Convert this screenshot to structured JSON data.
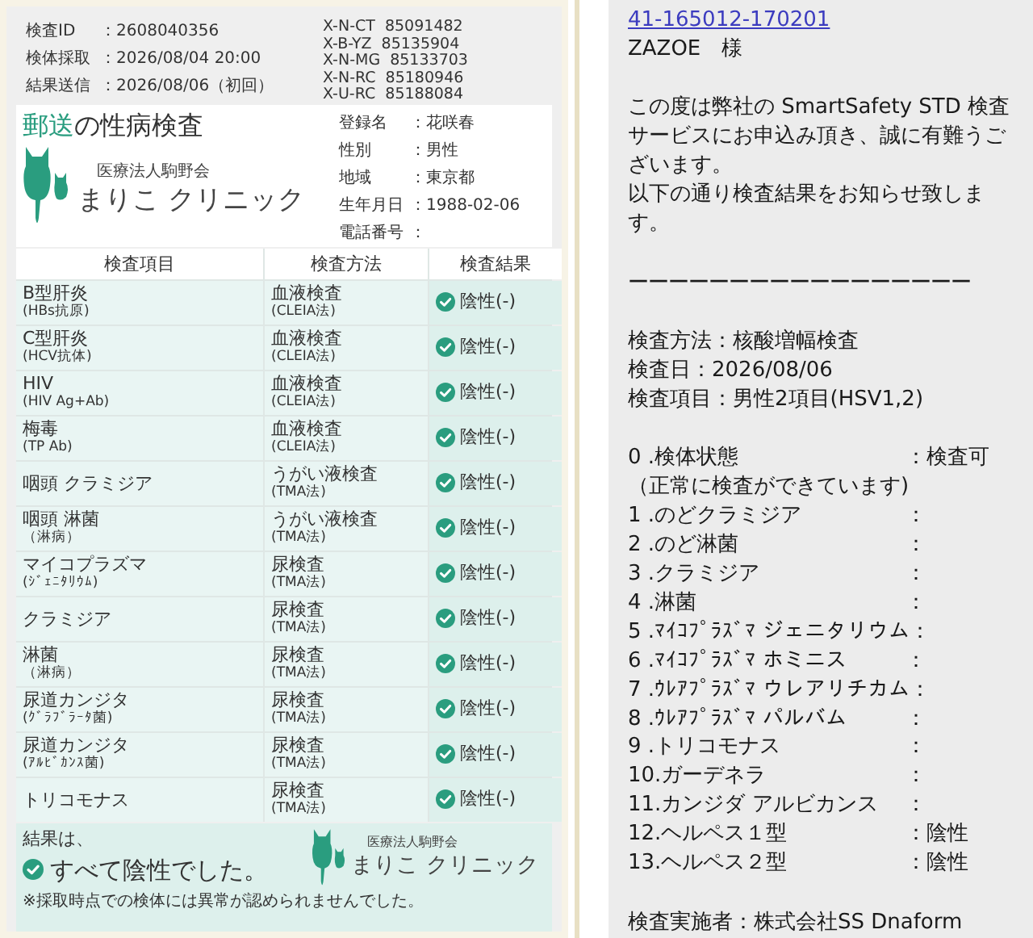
{
  "report": {
    "meta": [
      {
        "label": "検査ID",
        "value": "：2608040356"
      },
      {
        "label": "検体採取",
        "value": "：2026/08/04  20:00"
      },
      {
        "label": "結果送信",
        "value": "：2026/08/06（初回）"
      }
    ],
    "codes": [
      "X-N-CT  85091482",
      "X-B-YZ  85135904",
      "X-N-MG  85133703",
      "X-N-RC  85180946",
      "X-U-RC  85188084"
    ],
    "title": {
      "highlight": "郵送",
      "rest": "の性病検査"
    },
    "clinic": {
      "org": "医療法人駒野会",
      "name": "まりこ クリニック"
    },
    "patient": [
      {
        "label": "登録名",
        "value": "：花咲春"
      },
      {
        "label": "性別",
        "value": "：男性"
      },
      {
        "label": "地域",
        "value": "：東京都"
      },
      {
        "label": "生年月日",
        "value": "：1988-02-06"
      },
      {
        "label": "電話番号",
        "value": "："
      }
    ],
    "columns": [
      "検査項目",
      "検査方法",
      "検査結果"
    ],
    "rows": [
      {
        "item": "B型肝炎",
        "item_sub": "(HBs抗原)",
        "method": "血液検査",
        "method_sub": "(CLEIA法)",
        "result": "陰性(-)"
      },
      {
        "item": "C型肝炎",
        "item_sub": "(HCV抗体)",
        "method": "血液検査",
        "method_sub": "(CLEIA法)",
        "result": "陰性(-)"
      },
      {
        "item": "HIV",
        "item_sub": "(HIV  Ag+Ab)",
        "method": "血液検査",
        "method_sub": "(CLEIA法)",
        "result": "陰性(-)"
      },
      {
        "item": "梅毒",
        "item_sub": "(TP  Ab)",
        "method": "血液検査",
        "method_sub": "(CLEIA法)",
        "result": "陰性(-)"
      },
      {
        "item": "咽頭  クラミジア",
        "method": "うがい液検査",
        "method_sub": "(TMA法)",
        "result": "陰性(-)"
      },
      {
        "item": "咽頭  淋菌",
        "item_sub": "（淋病）",
        "method": "うがい液検査",
        "method_sub": "(TMA法)",
        "result": "陰性(-)"
      },
      {
        "item": "マイコプラズマ",
        "item_sub": "(ｼﾞｪﾆﾀﾘｳﾑ)",
        "method": "尿検査",
        "method_sub": "(TMA法)",
        "result": "陰性(-)"
      },
      {
        "item": "クラミジア",
        "method": "尿検査",
        "method_sub": "(TMA法)",
        "result": "陰性(-)"
      },
      {
        "item": "淋菌",
        "item_sub": "（淋病）",
        "method": "尿検査",
        "method_sub": "(TMA法)",
        "result": "陰性(-)"
      },
      {
        "item": "尿道カンジタ",
        "item_sub": "(ｸﾞﾗﾌﾞﾗｰﾀ菌)",
        "method": "尿検査",
        "method_sub": "(TMA法)",
        "result": "陰性(-)"
      },
      {
        "item": "尿道カンジタ",
        "item_sub": "(ｱﾙﾋﾞｶﾝｽ菌)",
        "method": "尿検査",
        "method_sub": "(TMA法)",
        "result": "陰性(-)"
      },
      {
        "item": "トリコモナス",
        "method": "尿検査",
        "method_sub": "(TMA法)",
        "result": "陰性(-)"
      }
    ],
    "summary": {
      "lead": "結果は、",
      "result": "すべて陰性でした。",
      "clinic": {
        "org": "医療法人駒野会",
        "name": "まりこ クリニック"
      },
      "note": "※採取時点での検体には異常が認められませんでした。"
    }
  },
  "message": {
    "link": "41-165012-170201",
    "recipient": "ZAZOE　様",
    "paragraphs": [
      "この度は弊社の SmartSafety STD 検査サービスにお申込み頂き、誠に有難うございます。",
      "以下の通り検査結果をお知らせ致します。"
    ],
    "separator": "ーーーーーーーーーーーーーーーーー",
    "info": [
      "検査方法：核酸増幅検査",
      "検査日：2026/08/06",
      "検査項目：男性2項目(HSV1,2)"
    ],
    "items": [
      {
        "name": "0 .検体状態",
        "value": "：検査可",
        "note": "（正常に検査ができています)"
      },
      {
        "name": "1 .のどクラミジア",
        "value": "："
      },
      {
        "name": "2 .のど淋菌",
        "value": "："
      },
      {
        "name": "3 .クラミジア",
        "value": "："
      },
      {
        "name": "4 .淋菌",
        "value": "："
      },
      {
        "name": "5 .ﾏｲｺﾌﾟﾗｽﾞﾏ ジェニタリウム",
        "value": "："
      },
      {
        "name": "6 .ﾏｲｺﾌﾟﾗｽﾞﾏ ホミニス",
        "value": "："
      },
      {
        "name": "7 .ｳﾚｱﾌﾟﾗｽﾞﾏ ウレアリチカム",
        "value": "："
      },
      {
        "name": "8 .ｳﾚｱﾌﾟﾗｽﾞﾏ パルバム",
        "value": "："
      },
      {
        "name": "9 .トリコモナス",
        "value": "："
      },
      {
        "name": "10.ガーデネラ",
        "value": "："
      },
      {
        "name": "11.カンジダ アルビカンス",
        "value": "："
      },
      {
        "name": "12.ヘルペス１型",
        "value": "：陰性"
      },
      {
        "name": "13.ヘルペス２型",
        "value": "：陰性"
      }
    ],
    "footer": "検査実施者：株式会社SS Dnaform"
  }
}
